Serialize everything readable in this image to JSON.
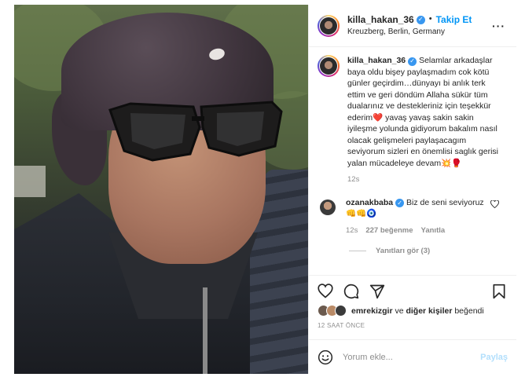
{
  "post": {
    "author": {
      "username": "killa_hakan_36",
      "verified_icon": "verified-badge-icon",
      "follow_label": "Takip Et",
      "location": "Kreuzberg, Berlin, Germany"
    },
    "caption": {
      "username": "killa_hakan_36",
      "text_part1": "Selamlar arkadaşlar baya oldu bişey paylaşmadım cok kötü günler geçirdim…dünyayı bi anlık terk ettim ve geri döndüm Allaha sükür tüm dualarınız ve destekleriniz için teşekkür ederim",
      "heart_emoji": "❤️",
      "text_part2": "yavaş yavaş sakin sakin iyileşme yolunda gidiyorum bakalım nasıl olacak gelişmeleri paylaşacagım seviyorum sizleri en önemlisi saglık gerisi yalan mücadeleye devam",
      "trailing_emojis": "💥🥊",
      "time": "12s"
    },
    "comments": [
      {
        "username": "ozanakbaba",
        "text": "Biz de seni seviyoruz",
        "emojis": "👊👊🧿",
        "time": "12s",
        "likes": "227 beğenme",
        "reply_label": "Yanıtla",
        "view_replies_label": "Yanıtları gör (3)"
      }
    ],
    "liked_by": {
      "user": "emrekizgir",
      "connector": "ve",
      "others": "diğer kişiler",
      "suffix": "beğendi"
    },
    "posted_ago": "12 SAAT ÖNCE",
    "comment_box": {
      "placeholder": "Yorum ekle...",
      "share_label": "Paylaş"
    },
    "colors": {
      "accent": "#0095f6",
      "verified": "#3897f0",
      "share_disabled": "#b2dffc",
      "muted": "#8e8e8e"
    },
    "icons": [
      "more-options-icon",
      "heart-icon",
      "comment-icon",
      "share-icon",
      "bookmark-icon",
      "emoji-icon"
    ]
  }
}
